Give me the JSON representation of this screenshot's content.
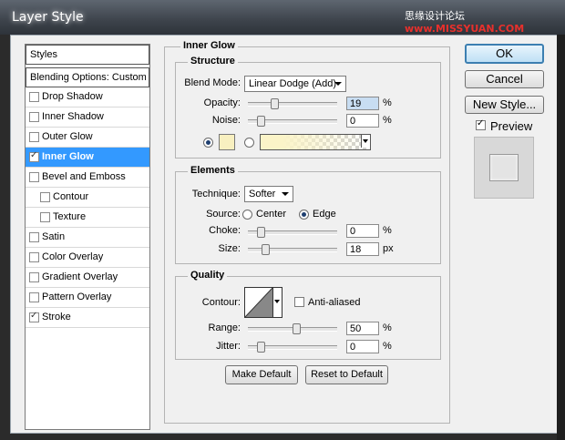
{
  "window": {
    "title": "Layer Style"
  },
  "watermark": {
    "prefix": "思缘设计论坛",
    "site": "www.MISSYUAN.COM"
  },
  "sidebar": {
    "header": "Styles",
    "blending": "Blending Options: Custom",
    "items": [
      {
        "label": "Drop Shadow",
        "checked": false
      },
      {
        "label": "Inner Shadow",
        "checked": false
      },
      {
        "label": "Outer Glow",
        "checked": false
      },
      {
        "label": "Inner Glow",
        "checked": true,
        "selected": true
      },
      {
        "label": "Bevel and Emboss",
        "checked": false
      },
      {
        "label": "Contour",
        "checked": false,
        "sub": true
      },
      {
        "label": "Texture",
        "checked": false,
        "sub": true
      },
      {
        "label": "Satin",
        "checked": false
      },
      {
        "label": "Color Overlay",
        "checked": false
      },
      {
        "label": "Gradient Overlay",
        "checked": false
      },
      {
        "label": "Pattern Overlay",
        "checked": false
      },
      {
        "label": "Stroke",
        "checked": true
      }
    ]
  },
  "panel": {
    "title": "Inner Glow",
    "structure": {
      "title": "Structure",
      "blend_mode_label": "Blend Mode:",
      "blend_mode_value": "Linear Dodge (Add)",
      "opacity_label": "Opacity:",
      "opacity_value": "19",
      "opacity_unit": "%",
      "opacity_level": 0.19,
      "noise_label": "Noise:",
      "noise_value": "0",
      "noise_unit": "%",
      "noise_level": 0,
      "color": "#f8f0c0"
    },
    "elements": {
      "title": "Elements",
      "technique_label": "Technique:",
      "technique_value": "Softer",
      "source_label": "Source:",
      "source_center": "Center",
      "source_edge": "Edge",
      "choke_label": "Choke:",
      "choke_value": "0",
      "choke_unit": "%",
      "choke_level": 0,
      "size_label": "Size:",
      "size_value": "18",
      "size_unit": "px",
      "size_level": 0.07
    },
    "quality": {
      "title": "Quality",
      "contour_label": "Contour:",
      "anti_aliased": "Anti-aliased",
      "range_label": "Range:",
      "range_value": "50",
      "range_unit": "%",
      "range_level": 0.5,
      "jitter_label": "Jitter:",
      "jitter_value": "0",
      "jitter_unit": "%",
      "jitter_level": 0
    },
    "make_default": "Make Default",
    "reset_default": "Reset to Default"
  },
  "actions": {
    "ok": "OK",
    "cancel": "Cancel",
    "new_style": "New Style...",
    "preview": "Preview"
  }
}
